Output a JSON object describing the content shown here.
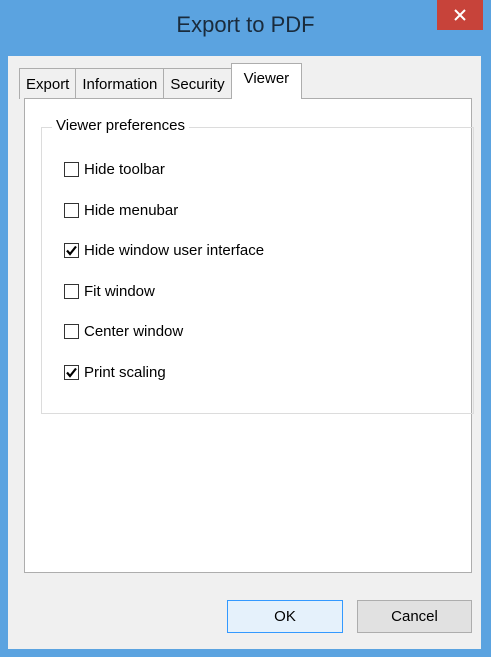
{
  "window": {
    "title": "Export to PDF",
    "close_icon": "close-icon"
  },
  "tabs": [
    {
      "label": "Export",
      "active": false
    },
    {
      "label": "Information",
      "active": false
    },
    {
      "label": "Security",
      "active": false
    },
    {
      "label": "Viewer",
      "active": true
    }
  ],
  "viewer": {
    "group_label": "Viewer preferences",
    "options": [
      {
        "label": "Hide toolbar",
        "checked": false
      },
      {
        "label": "Hide menubar",
        "checked": false
      },
      {
        "label": "Hide window user interface",
        "checked": true
      },
      {
        "label": "Fit window",
        "checked": false
      },
      {
        "label": "Center window",
        "checked": false
      },
      {
        "label": "Print scaling",
        "checked": true
      }
    ]
  },
  "buttons": {
    "ok_label": "OK",
    "cancel_label": "Cancel"
  },
  "colors": {
    "titlebar": "#5ba3e0",
    "close": "#c7433a",
    "accent": "#3399ff"
  }
}
